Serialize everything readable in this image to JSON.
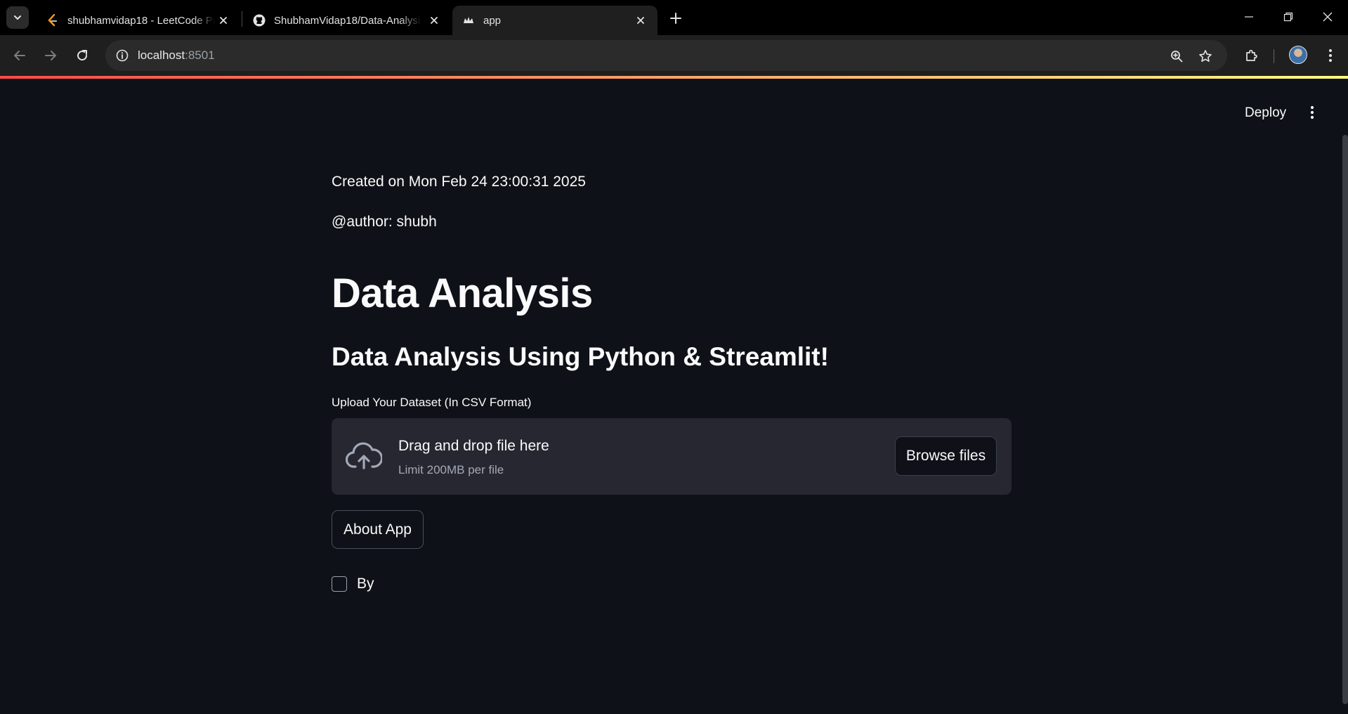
{
  "browser": {
    "tabs": [
      {
        "title": "shubhamvidap18 - LeetCode Pr",
        "favicon": "leetcode-icon",
        "active": false
      },
      {
        "title": "ShubhamVidap18/Data-Analysis",
        "favicon": "github-icon",
        "active": false
      },
      {
        "title": "app",
        "favicon": "streamlit-icon",
        "active": true
      }
    ],
    "url_host": "localhost",
    "url_port": ":8501"
  },
  "header": {
    "deploy_label": "Deploy"
  },
  "content": {
    "created_on": "Created on Mon Feb 24 23:00:31 2025",
    "author": "@author: shubh",
    "title": "Data Analysis",
    "subtitle": "Data Analysis Using Python & Streamlit!",
    "upload_label": "Upload Your Dataset (In CSV Format)",
    "dropzone_title": "Drag and drop file here",
    "dropzone_limit": "Limit 200MB per file",
    "browse_label": "Browse files",
    "about_label": "About App",
    "checkbox_label": "By",
    "checkbox_checked": false
  },
  "colors": {
    "background": "#0e1117",
    "secondary_bg": "#262730",
    "text": "#fafafa",
    "accent_start": "#ff4b4b",
    "accent_end": "#fffd80"
  }
}
